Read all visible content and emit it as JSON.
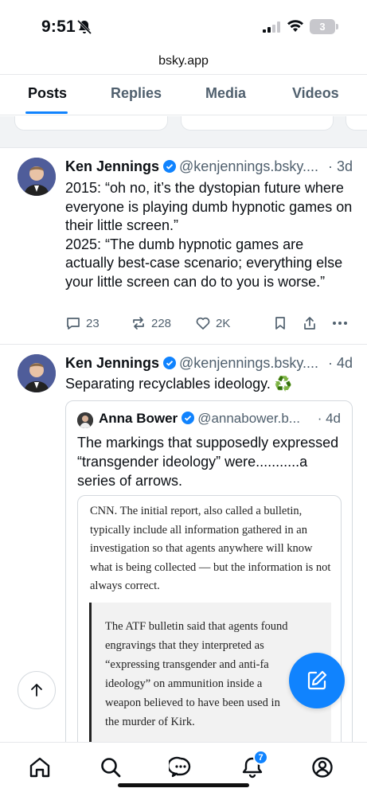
{
  "status_bar": {
    "time": "9:51",
    "battery": "3"
  },
  "url": "bsky.app",
  "tabs": [
    {
      "label": "Posts",
      "active": true
    },
    {
      "label": "Replies",
      "active": false
    },
    {
      "label": "Media",
      "active": false
    },
    {
      "label": "Videos",
      "active": false
    }
  ],
  "posts": [
    {
      "author": "Ken Jennings",
      "handle": "@kenjennings.bsky....",
      "time": "· 3d",
      "text_lines": [
        "2015: “oh no, it’s the dystopian future where everyone is playing dumb hypnotic games on their little screen.”",
        "2025: “The dumb hypnotic games are actually best-case scenario; everything else your little screen can do to you is worse.”"
      ],
      "replies": "23",
      "reposts": "228",
      "likes": "2K"
    },
    {
      "author": "Ken Jennings",
      "handle": "@kenjennings.bsky....",
      "time": "· 4d",
      "text": "Separating recyclables ideology. ♻️",
      "quote": {
        "author": "Anna Bower",
        "handle": "@annabower.b...",
        "time": "· 4d",
        "text": "The markings that supposedly expressed “transgender ideology” were...........a series of arrows.",
        "article_paragraph": "CNN. The initial report, also called a bulletin, typically include all information gathered in an investigation so that agents anywhere will know what is being collected — but the information is not always correct.",
        "article_quote_lines": [
          "The ATF bulletin said that agents found",
          "engravings that they interpreted as",
          "“expressing transgender and anti-fa",
          "ideology” on ammunition inside a",
          "weapon believed to have been used in",
          "the murder of Kirk."
        ]
      }
    }
  ],
  "notifications_badge": "7",
  "colors": {
    "accent": "#1083fe",
    "muted": "#50606e",
    "border": "#e6e8eb"
  }
}
